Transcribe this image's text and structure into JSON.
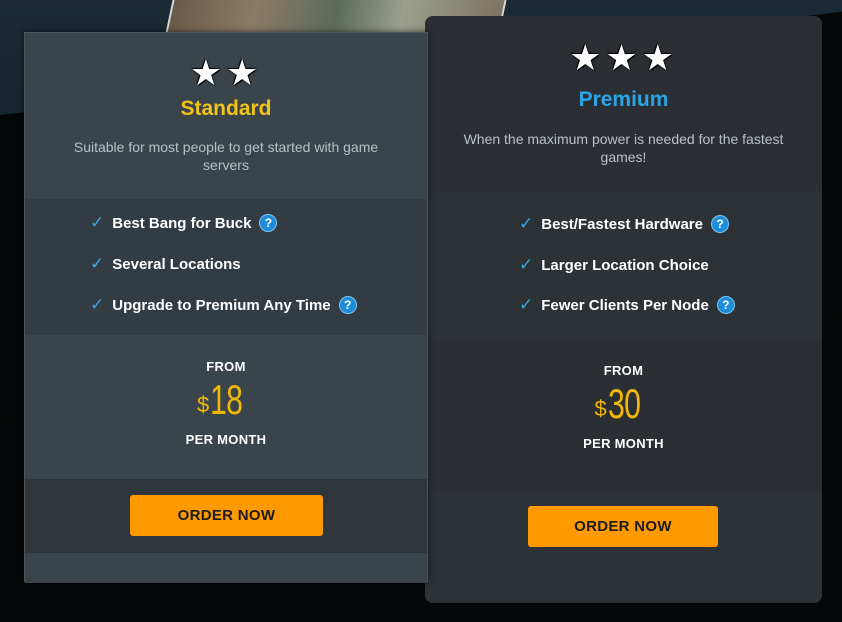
{
  "plans": [
    {
      "stars": "★★",
      "title": "Standard",
      "title_color": "#f2c319",
      "description": "Suitable for most people to get started with game servers",
      "features": [
        {
          "label": "Best Bang for Buck",
          "has_help": true
        },
        {
          "label": "Several Locations",
          "has_help": false
        },
        {
          "label": "Upgrade to Premium Any Time",
          "has_help": true
        }
      ],
      "from_label": "FROM",
      "currency": "$",
      "price": "18",
      "per_label": "PER MONTH",
      "order_label": "ORDER NOW"
    },
    {
      "stars": "★★★",
      "title": "Premium",
      "title_color": "#2aa6e8",
      "description": "When the maximum power is needed for the fastest games!",
      "features": [
        {
          "label": "Best/Fastest Hardware",
          "has_help": true
        },
        {
          "label": "Larger Location Choice",
          "has_help": false
        },
        {
          "label": "Fewer Clients Per Node",
          "has_help": true
        }
      ],
      "from_label": "FROM",
      "currency": "$",
      "price": "30",
      "per_label": "PER MONTH",
      "order_label": "ORDER NOW"
    }
  ],
  "help_glyph": "?",
  "check_glyph": "✓",
  "colors": {
    "accent_orange": "#ff9900",
    "price_yellow": "#f2b705",
    "check_blue": "#3aa7e6"
  }
}
